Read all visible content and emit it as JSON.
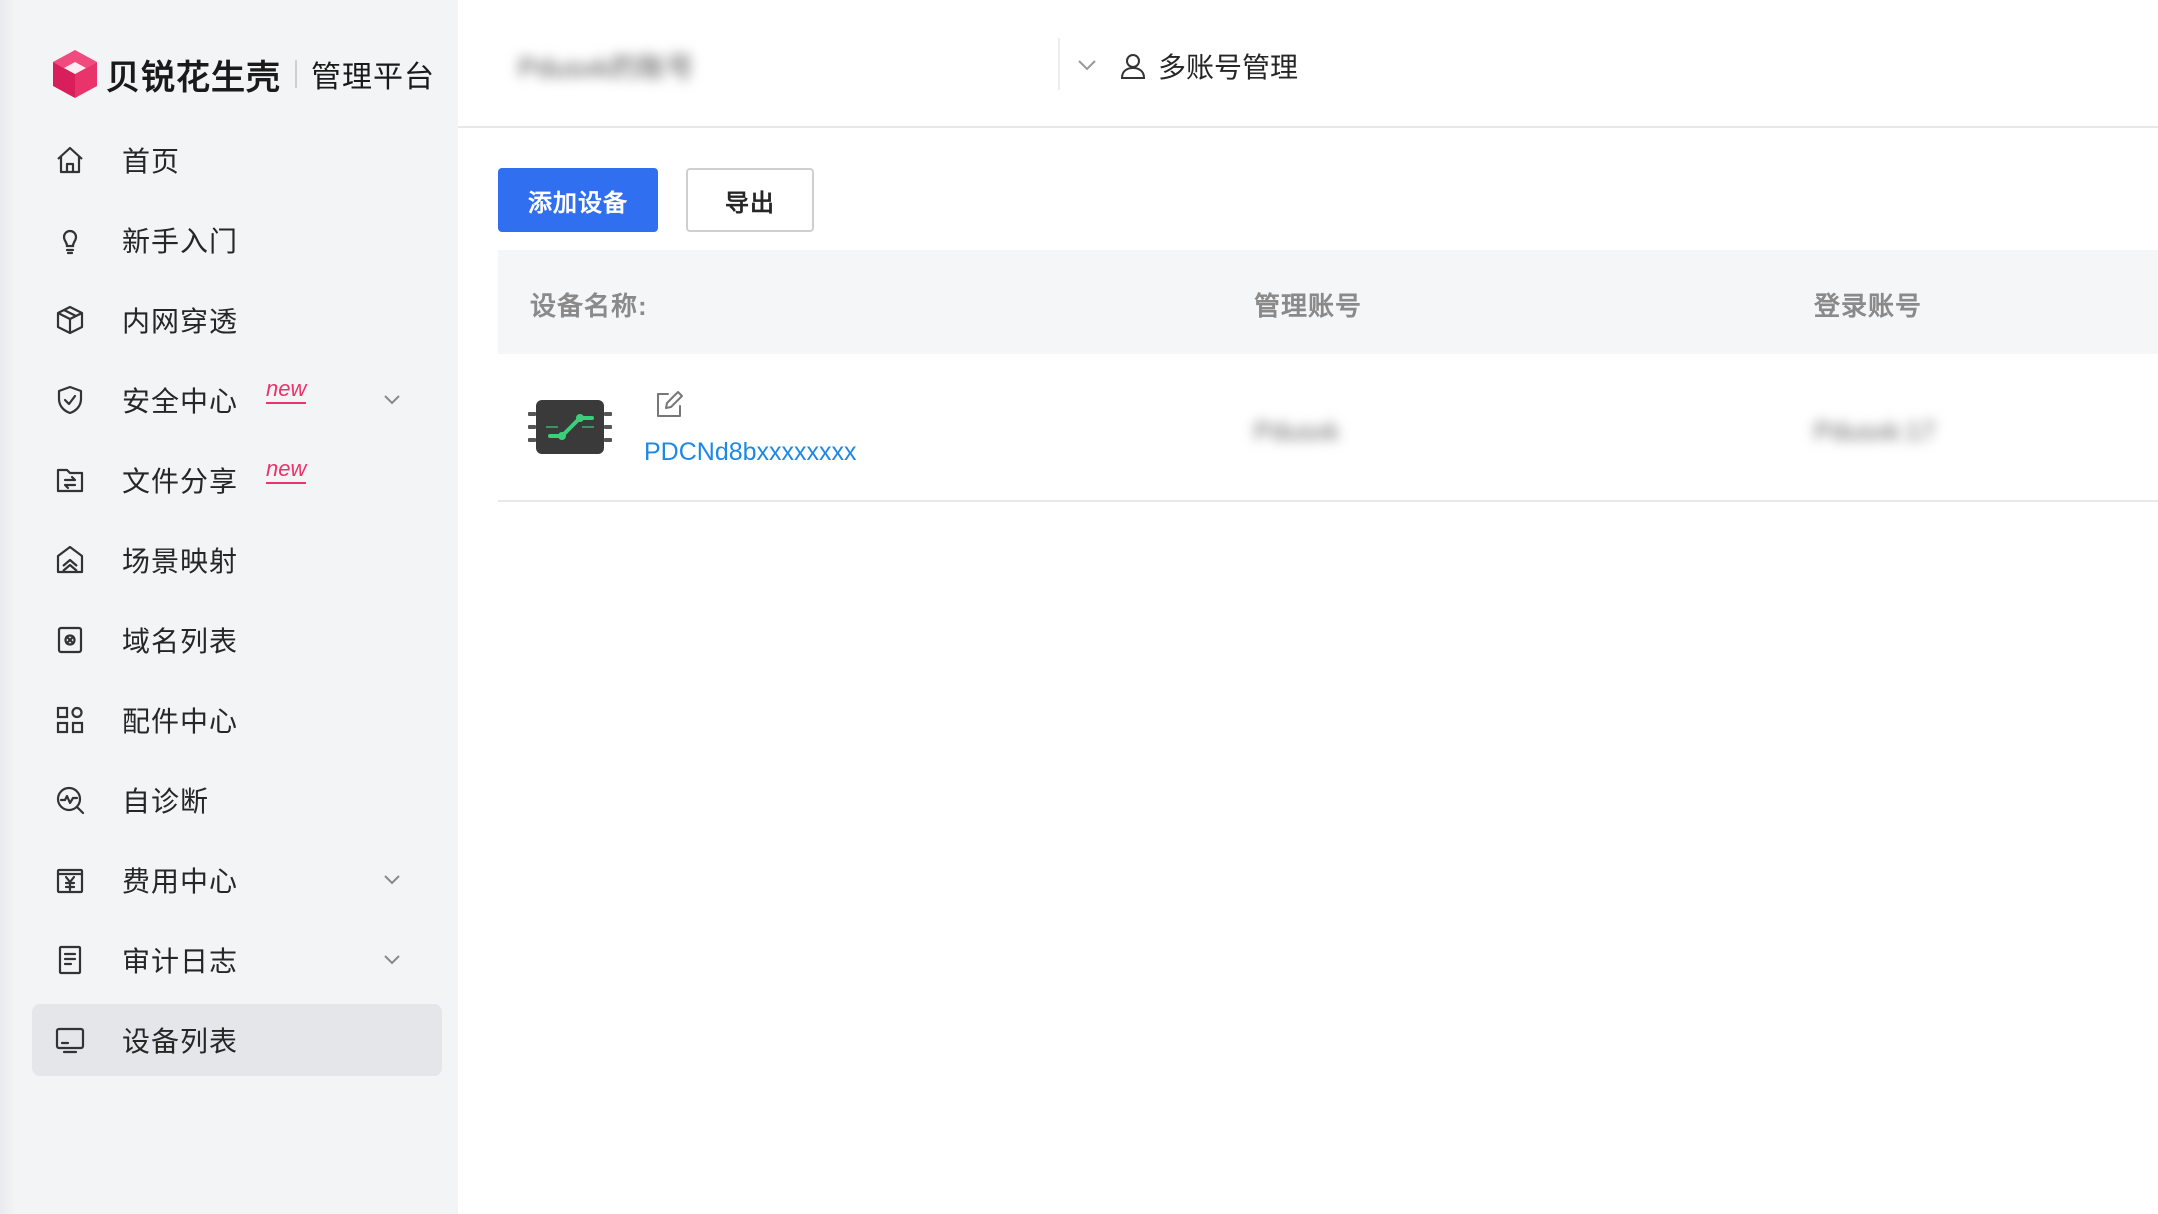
{
  "brand": {
    "name": "贝锐花生壳",
    "subtitle": "管理平台",
    "logo_icon": "cube-logo-icon",
    "accent_color": "#e8336b"
  },
  "sidebar": {
    "items": [
      {
        "label": "首页",
        "icon": "home-icon",
        "new": false,
        "expandable": false,
        "active": false
      },
      {
        "label": "新手入门",
        "icon": "lightbulb-icon",
        "new": false,
        "expandable": false,
        "active": false
      },
      {
        "label": "内网穿透",
        "icon": "cube-icon",
        "new": false,
        "expandable": false,
        "active": false
      },
      {
        "label": "安全中心",
        "icon": "shield-icon",
        "new": true,
        "new_label": "new",
        "expandable": true,
        "active": false
      },
      {
        "label": "文件分享",
        "icon": "file-share-icon",
        "new": true,
        "new_label": "new",
        "expandable": false,
        "active": false
      },
      {
        "label": "场景映射",
        "icon": "scene-map-icon",
        "new": false,
        "expandable": false,
        "active": false
      },
      {
        "label": "域名列表",
        "icon": "domain-icon",
        "new": false,
        "expandable": false,
        "active": false
      },
      {
        "label": "配件中心",
        "icon": "grid-icon",
        "new": false,
        "expandable": false,
        "active": false
      },
      {
        "label": "自诊断",
        "icon": "diagnose-icon",
        "new": false,
        "expandable": false,
        "active": false
      },
      {
        "label": "费用中心",
        "icon": "billing-icon",
        "new": false,
        "expandable": true,
        "active": false
      },
      {
        "label": "审计日志",
        "icon": "log-icon",
        "new": false,
        "expandable": true,
        "active": false
      },
      {
        "label": "设备列表",
        "icon": "monitor-icon",
        "new": false,
        "expandable": false,
        "active": true
      }
    ]
  },
  "topbar": {
    "account_value": "Pdusxk的账号",
    "multi_account_label": "多账号管理",
    "multi_account_icon": "user-icon"
  },
  "toolbar": {
    "add_label": "添加设备",
    "export_label": "导出",
    "primary_color": "#2f6ff0"
  },
  "table": {
    "headers": {
      "device_name": "设备名称:",
      "manage_account": "管理账号",
      "login_account": "登录账号"
    },
    "rows": [
      {
        "device_name": "PDCNd8bxxxxxxxx",
        "manage_account": "Pdusxk",
        "login_account": "Pdusxk:17"
      }
    ]
  }
}
